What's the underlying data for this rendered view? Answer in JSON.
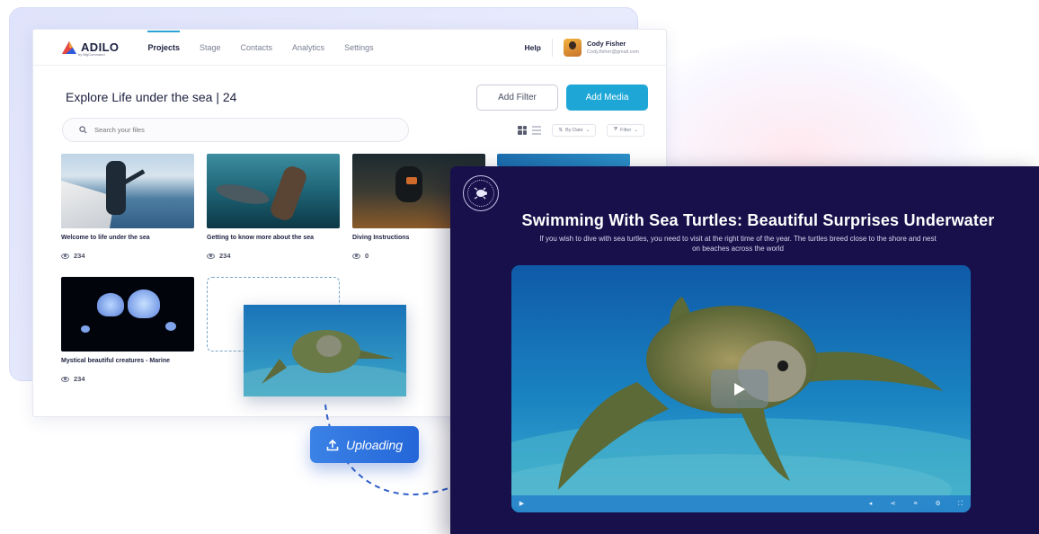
{
  "logo": {
    "name": "ADILO",
    "sub": "by BigCommand"
  },
  "nav": {
    "items": [
      {
        "label": "Projects",
        "active": true
      },
      {
        "label": "Stage"
      },
      {
        "label": "Contacts"
      },
      {
        "label": "Analytics"
      },
      {
        "label": "Settings"
      }
    ],
    "help": "Help",
    "user": {
      "name": "Cody Fisher",
      "email": "Cody.fisher@gmail.com"
    }
  },
  "page": {
    "title": "Explore Life under the sea | 24"
  },
  "actions": {
    "add_filter": "Add Filter",
    "add_media": "Add Media"
  },
  "search": {
    "placeholder": "Search your files"
  },
  "toolbar": {
    "sort_label": "By Date",
    "filter_label": "Filter"
  },
  "media": [
    {
      "title": "Welcome to life under the sea",
      "views": "234"
    },
    {
      "title": "Getting to know more about the sea",
      "views": "234"
    },
    {
      "title": "Diving Instructions",
      "views": "0"
    },
    {
      "title": "",
      "views": ""
    },
    {
      "title": "Mystical beautiful creatures - Marine",
      "views": "234"
    }
  ],
  "upload": {
    "label": "Uploading"
  },
  "player": {
    "title": "Swimming With Sea Turtles: Beautiful Surprises Underwater",
    "description": "If you wish to dive with sea turtles, you need to visit at the right time of the year. The turtles breed close to the shore and nest on beaches across the world"
  },
  "colors": {
    "accent": "#1ea7d6",
    "player_bg": "#17104a",
    "upload": "#2f72e0"
  }
}
